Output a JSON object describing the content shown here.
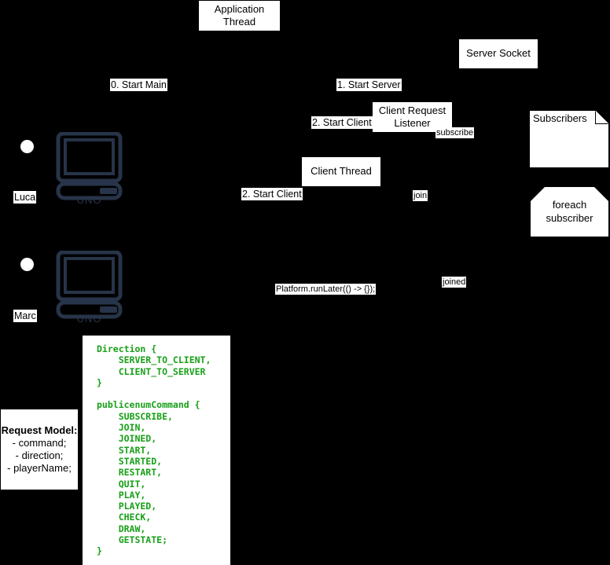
{
  "diagram": {
    "title": "Client / Server threading sequence diagram",
    "background_color": "#000000",
    "box_fill": "#ffffff",
    "code_text_color": "#18a018",
    "device_color": "#273449"
  },
  "boxes": {
    "application_thread": "Application Thread",
    "server_socket": "Server Socket",
    "client_request_listener": "Client Request Listener",
    "client_thread": "Client Thread"
  },
  "labels": {
    "start_main": "0. Start Main",
    "start_server": "1. Start Server",
    "start_client_top": "2. Start Client",
    "start_client_bottom": "2. Start Client",
    "subscribe": "subscribe",
    "join": "join",
    "joined": "joined",
    "platform_runlater": "Platform.runLater(() -> {});"
  },
  "actors": [
    {
      "name": "Luca",
      "device": "UNO"
    },
    {
      "name": "Marc",
      "device": "UNO"
    }
  ],
  "subscribers_doc": {
    "title": "Subscribers"
  },
  "foreach_loop": {
    "line1": "foreach",
    "line2": "subscriber"
  },
  "request_model": {
    "title": "Request Model:",
    "fields": [
      "- command;",
      "- direction;",
      "- playerName;"
    ]
  },
  "code_panel": {
    "text": "Direction {\n    SERVER_TO_CLIENT,\n    CLIENT_TO_SERVER\n}\n\npublicenumCommand {\n    SUBSCRIBE,\n    JOIN,\n    JOINED,\n    START,\n    STARTED,\n    RESTART,\n    QUIT,\n    PLAY,\n    PLAYED,\n    CHECK,\n    DRAW,\n    GETSTATE;\n}"
  }
}
